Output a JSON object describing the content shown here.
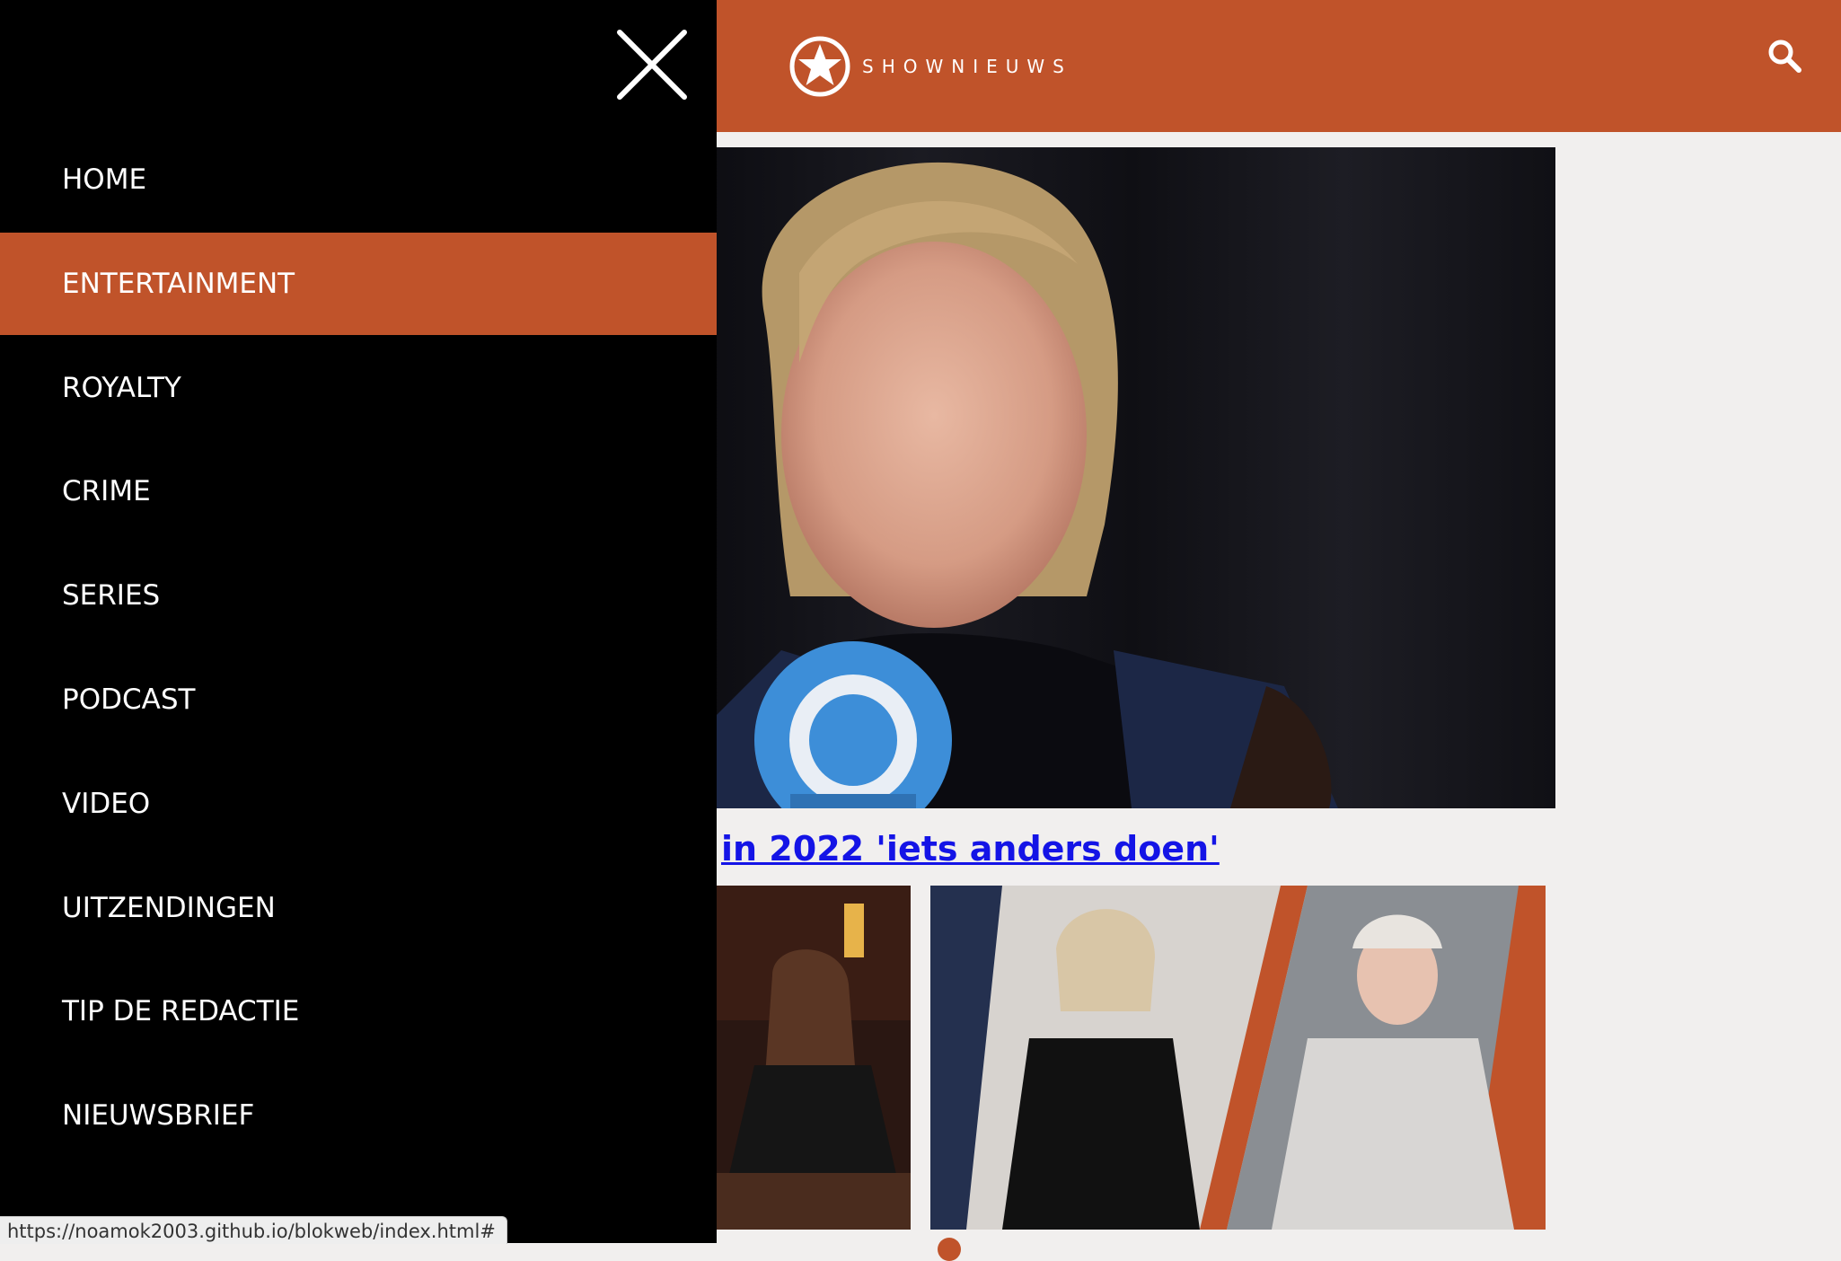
{
  "header": {
    "logo_text": "SHOWNIEUWS",
    "search_icon": "search-icon"
  },
  "menu": {
    "close_icon": "close-icon",
    "items": [
      {
        "label": "HOME",
        "active": false
      },
      {
        "label": "ENTERTAINMENT",
        "active": true
      },
      {
        "label": "ROYALTY",
        "active": false
      },
      {
        "label": "CRIME",
        "active": false
      },
      {
        "label": "SERIES",
        "active": false
      },
      {
        "label": "PODCAST",
        "active": false
      },
      {
        "label": "VIDEO",
        "active": false
      },
      {
        "label": "UITZENDINGEN",
        "active": false
      },
      {
        "label": "TIP DE REDACTIE",
        "active": false
      },
      {
        "label": "NIEUWSBRIEF",
        "active": false
      }
    ]
  },
  "main": {
    "headline_visible": "in 2022 'iets anders doen'"
  },
  "status_bar": {
    "url": "https://noamok2003.github.io/blokweb/index.html#"
  },
  "colors": {
    "brand": "#c0532a",
    "menu_background": "#000000",
    "page_background": "#f1efee",
    "link": "#1414e6"
  }
}
